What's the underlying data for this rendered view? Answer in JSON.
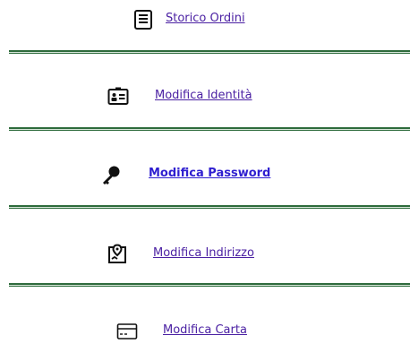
{
  "menu": {
    "items": [
      {
        "label": "Storico Ordini",
        "icon": "order-list-icon"
      },
      {
        "label": "Modifica Identità",
        "icon": "id-card-icon"
      },
      {
        "label": "Modifica Password",
        "icon": "key-icon"
      },
      {
        "label": "Modifica Indirizzo",
        "icon": "map-pin-icon"
      },
      {
        "label": "Modifica Carta",
        "icon": "credit-card-icon"
      }
    ]
  },
  "colors": {
    "link": "#4b21a3",
    "link_bold": "#2f1fd0",
    "separator": "#2e6b3c"
  }
}
